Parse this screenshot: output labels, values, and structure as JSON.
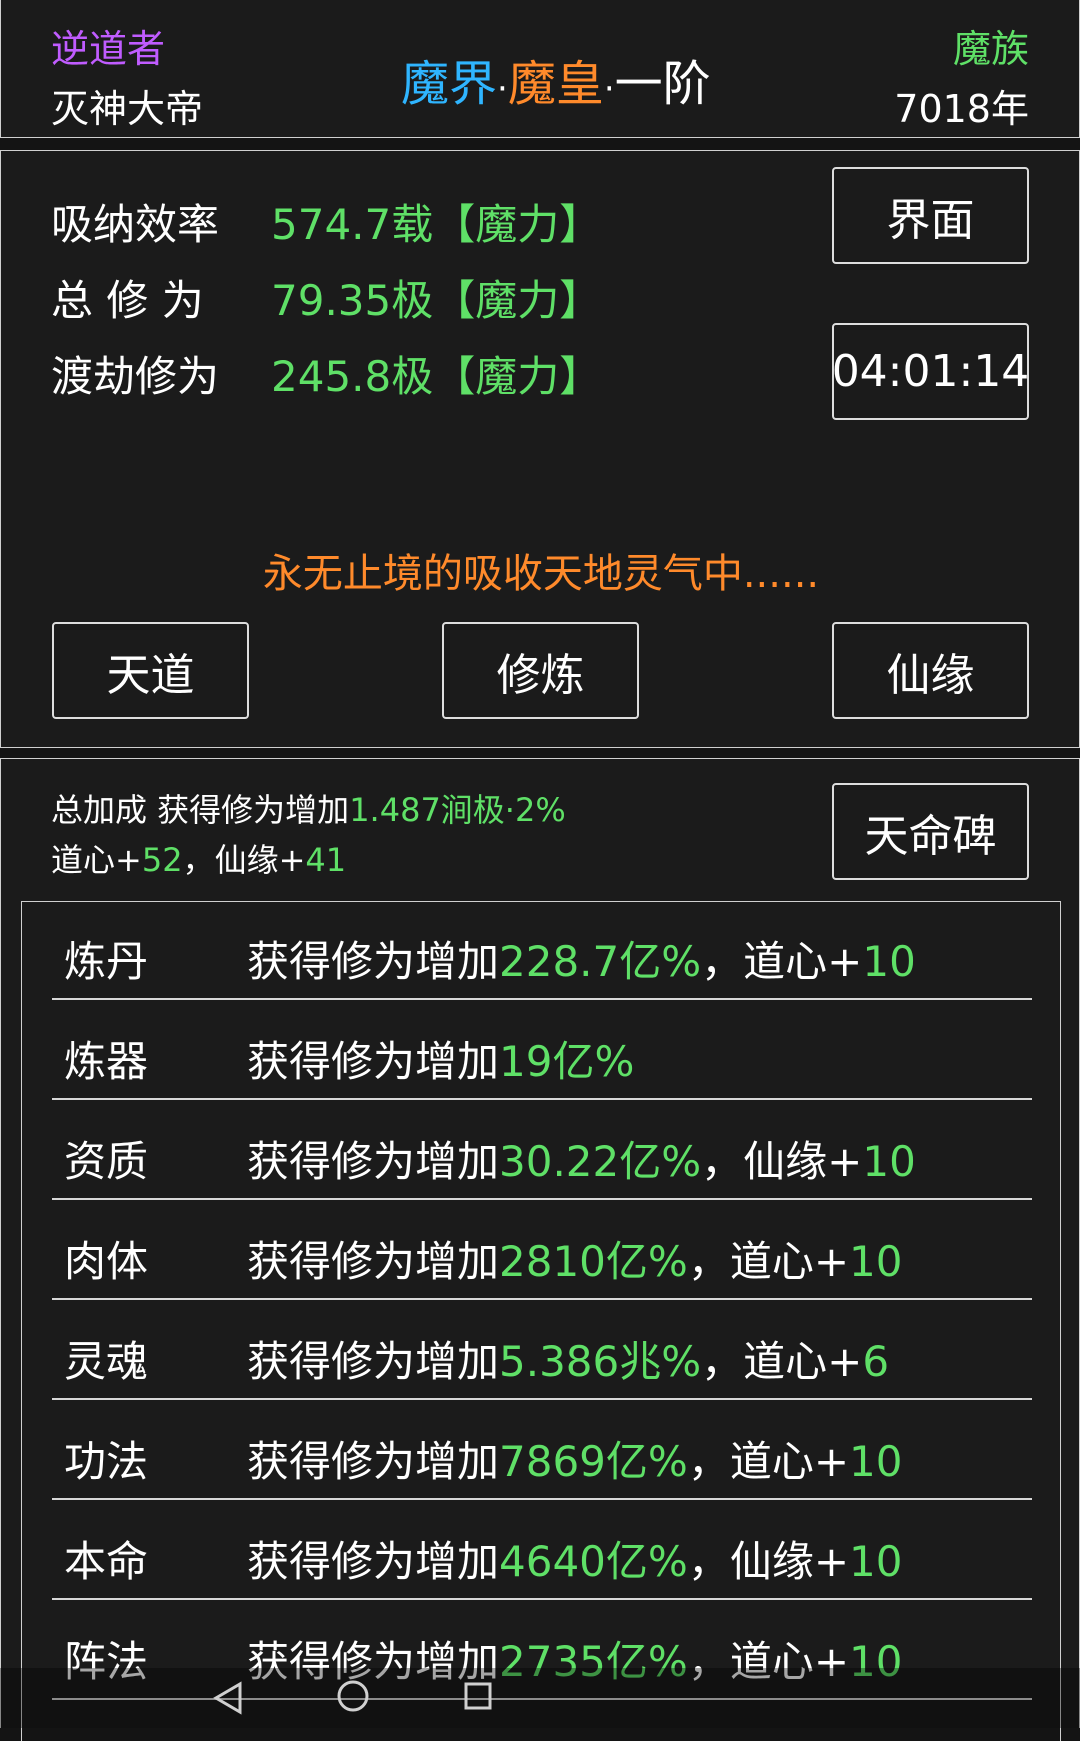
{
  "colors": {
    "purple": "#c05cff",
    "cyan": "#2fb5ff",
    "orange": "#ff8a2b",
    "green": "#5fe067",
    "white": "#ffffff"
  },
  "header": {
    "role": "逆道者",
    "name": "灭神大帝",
    "realm_part1": "魔界",
    "realm_sep1": "·",
    "realm_part2": "魔皇",
    "realm_sep2": "·",
    "realm_part3": "一阶",
    "race": "魔族",
    "year": "7018年"
  },
  "stats": {
    "absorb_label": "吸纳效率",
    "absorb_value": "574.7载【魔力】",
    "total_label": "总 修 为",
    "total_value": "79.35极【魔力】",
    "tribulation_label": "渡劫修为",
    "tribulation_value": "245.8极【魔力】",
    "interface_button": "界面",
    "timer": "04:01:14",
    "status_message": "永无止境的吸收天地灵气中......"
  },
  "actions": {
    "tiandao": "天道",
    "xiulian": "修炼",
    "xianyuan": "仙缘"
  },
  "bonus": {
    "summary_prefix": "总加成 获得修为增加",
    "summary_value": "1.487涧极·2%",
    "daoxin_label": "道心+",
    "daoxin_value": "52",
    "comma": "，",
    "xianyuan_label": "仙缘+",
    "xianyuan_value": "41",
    "stele_button": "天命碑"
  },
  "bonus_rows": [
    {
      "label": "炼丹",
      "prefix": "获得修为增加",
      "value": "228.7亿%",
      "suffix_label": "，道心+",
      "suffix_value": "10"
    },
    {
      "label": "炼器",
      "prefix": "获得修为增加",
      "value": "19亿%",
      "suffix_label": "",
      "suffix_value": ""
    },
    {
      "label": "资质",
      "prefix": "获得修为增加",
      "value": "30.22亿%",
      "suffix_label": "，仙缘+",
      "suffix_value": "10"
    },
    {
      "label": "肉体",
      "prefix": "获得修为增加",
      "value": "2810亿%",
      "suffix_label": "，道心+",
      "suffix_value": "10"
    },
    {
      "label": "灵魂",
      "prefix": "获得修为增加",
      "value": "5.386兆%",
      "suffix_label": "，道心+",
      "suffix_value": "6"
    },
    {
      "label": "功法",
      "prefix": "获得修为增加",
      "value": "7869亿%",
      "suffix_label": "，道心+",
      "suffix_value": "10"
    },
    {
      "label": "本命",
      "prefix": "获得修为增加",
      "value": "4640亿%",
      "suffix_label": "，仙缘+",
      "suffix_value": "10"
    },
    {
      "label": "阵法",
      "prefix": "获得修为增加",
      "value": "2735亿%",
      "suffix_label": "，道心+",
      "suffix_value": "10"
    }
  ],
  "nav": {
    "back_icon": "triangle-back-icon",
    "home_icon": "circle-home-icon",
    "recent_icon": "square-recent-icon"
  }
}
